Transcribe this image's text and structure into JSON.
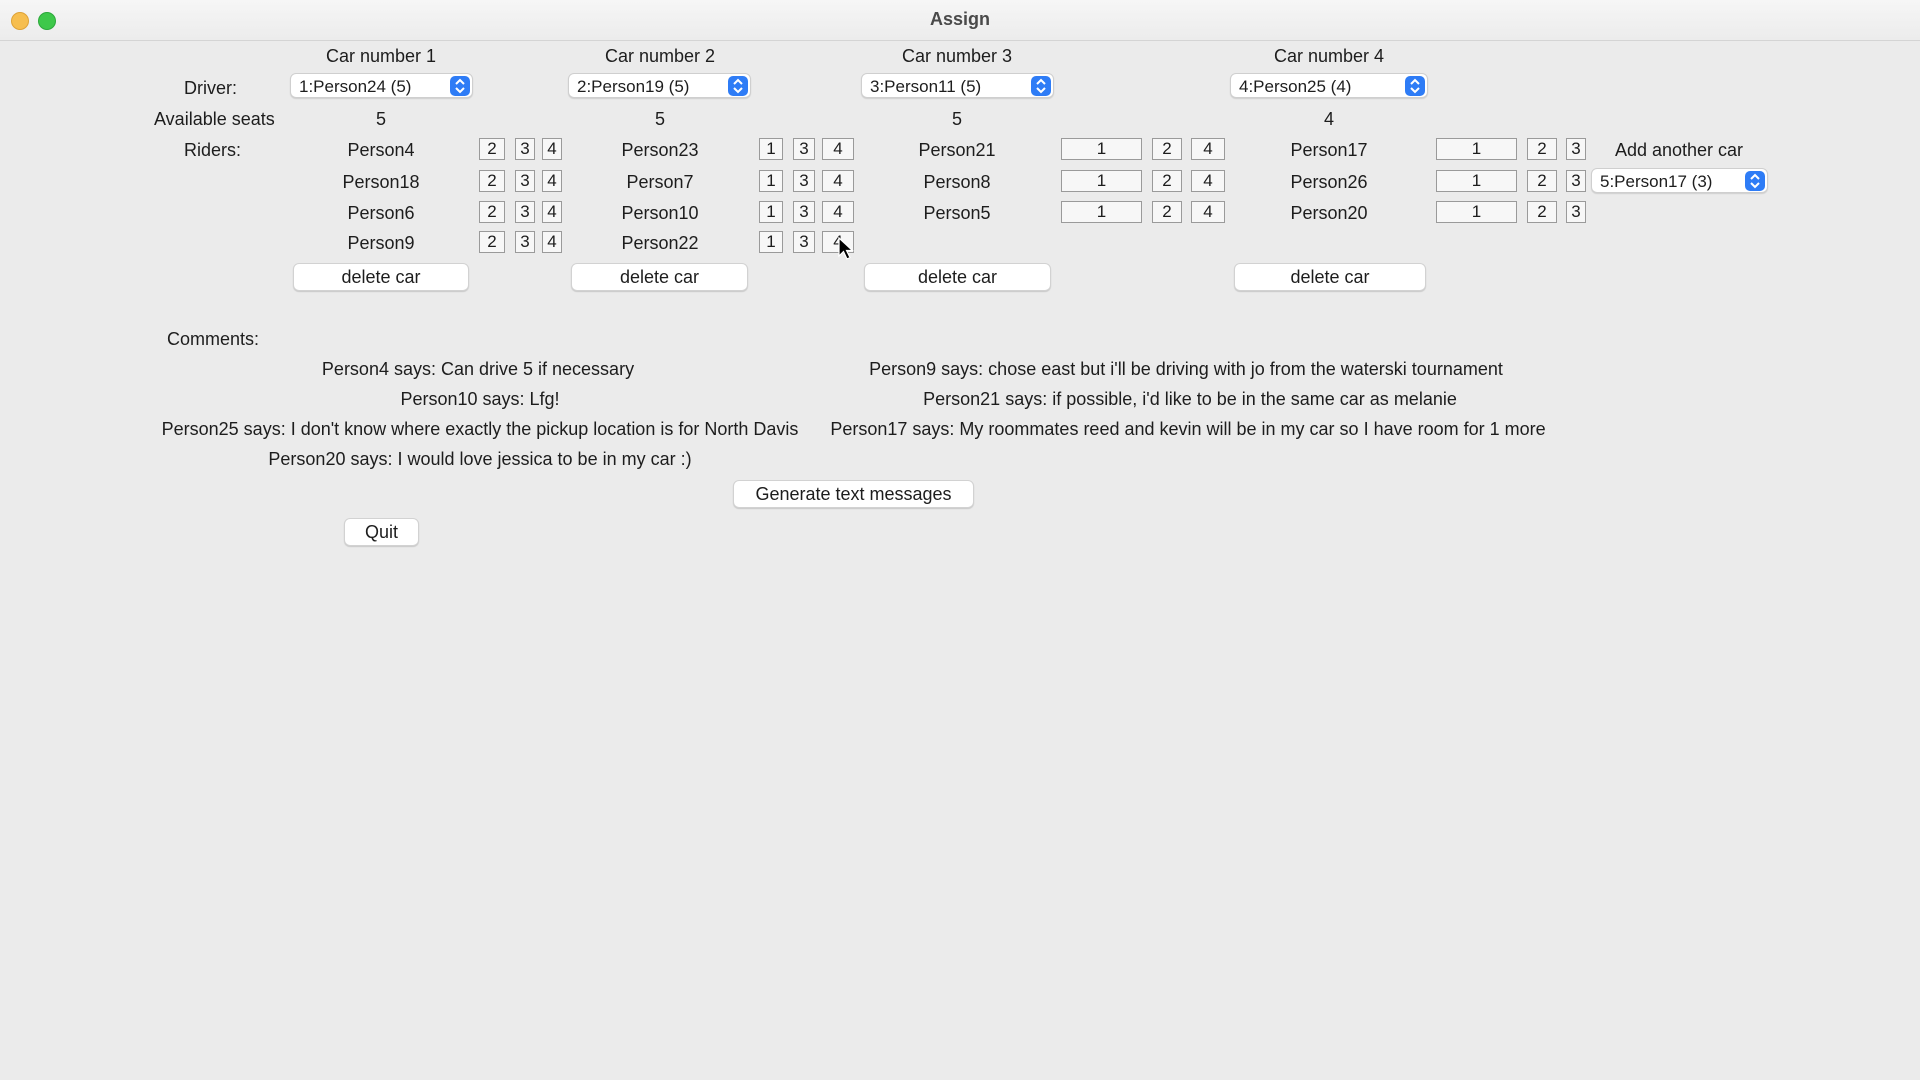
{
  "window": {
    "title": "Assign"
  },
  "labels": {
    "driver": "Driver:",
    "available_seats": "Available seats",
    "riders": "Riders:",
    "comments": "Comments:"
  },
  "cars": [
    {
      "title": "Car number 1",
      "driver": "1:Person24 (5)",
      "seats": "5",
      "riders": [
        {
          "name": "Person4",
          "moves": [
            "2",
            "3",
            "4"
          ]
        },
        {
          "name": "Person18",
          "moves": [
            "2",
            "3",
            "4"
          ]
        },
        {
          "name": "Person6",
          "moves": [
            "2",
            "3",
            "4"
          ]
        },
        {
          "name": "Person9",
          "moves": [
            "2",
            "3",
            "4"
          ]
        }
      ],
      "delete_label": "delete car"
    },
    {
      "title": "Car number 2",
      "driver": "2:Person19 (5)",
      "seats": "5",
      "riders": [
        {
          "name": "Person23",
          "moves": [
            "1",
            "3",
            "4"
          ]
        },
        {
          "name": "Person7",
          "moves": [
            "1",
            "3",
            "4"
          ]
        },
        {
          "name": "Person10",
          "moves": [
            "1",
            "3",
            "4"
          ]
        },
        {
          "name": "Person22",
          "moves": [
            "1",
            "3",
            "4"
          ]
        }
      ],
      "delete_label": "delete car"
    },
    {
      "title": "Car number 3",
      "driver": "3:Person11 (5)",
      "seats": "5",
      "riders": [
        {
          "name": "Person21",
          "moves": [
            "1",
            "2",
            "4"
          ]
        },
        {
          "name": "Person8",
          "moves": [
            "1",
            "2",
            "4"
          ]
        },
        {
          "name": "Person5",
          "moves": [
            "1",
            "2",
            "4"
          ]
        }
      ],
      "delete_label": "delete car"
    },
    {
      "title": "Car number 4",
      "driver": "4:Person25 (4)",
      "seats": "4",
      "riders": [
        {
          "name": "Person17",
          "moves": [
            "1",
            "2",
            "3"
          ]
        },
        {
          "name": "Person26",
          "moves": [
            "1",
            "2",
            "3"
          ]
        },
        {
          "name": "Person20",
          "moves": [
            "1",
            "2",
            "3"
          ]
        }
      ],
      "delete_label": "delete car"
    }
  ],
  "add_car": {
    "label": "Add another car",
    "selected": "5:Person17 (3)"
  },
  "comments": {
    "left": [
      "Person4 says: Can drive 5 if necessary",
      "Person10 says: Lfg!",
      "Person25 says: I don't know where exactly the pickup location is for North Davis",
      "Person20 says: I would love jessica to be in my car :)"
    ],
    "right": [
      "Person9 says: chose east but i'll be driving with jo from the waterski tournament",
      "Person21 says: if possible, i'd like to be in the same car as melanie",
      "Person17 says: My roommates reed and kevin will be in my car so I have room for 1 more"
    ]
  },
  "buttons": {
    "generate": "Generate text messages",
    "quit": "Quit"
  },
  "colors": {
    "accent": "#2e7cf6",
    "background": "#ebebeb"
  }
}
